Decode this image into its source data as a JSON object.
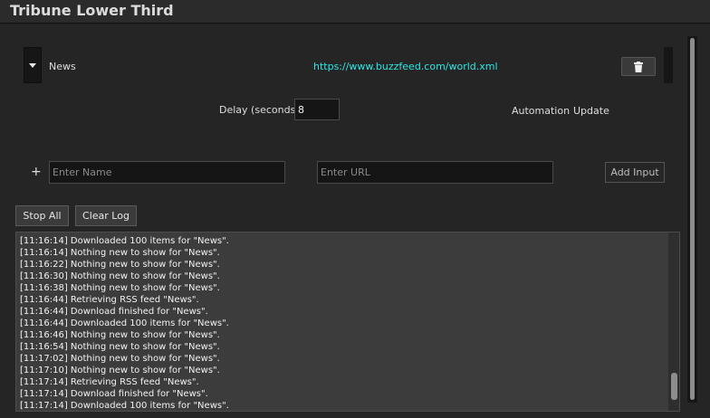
{
  "window": {
    "title": "Tribune Lower Third"
  },
  "feed": {
    "name": "News",
    "url": "https://www.buzzfeed.com/world.xml"
  },
  "settings": {
    "delay_label": "Delay (seconds)",
    "delay_value": "8",
    "automation_label": "Automation",
    "update_label": "Update"
  },
  "add_form": {
    "plus": "+",
    "name_placeholder": "Enter Name",
    "url_placeholder": "Enter URL",
    "add_label": "Add Input"
  },
  "controls": {
    "stop_all_label": "Stop All",
    "clear_log_label": "Clear Log"
  },
  "log": [
    "[11:16:14] Downloaded 100 items for \"News\".",
    "[11:16:14] Nothing new to show for \"News\".",
    "[11:16:22] Nothing new to show for \"News\".",
    "[11:16:30] Nothing new to show for \"News\".",
    "[11:16:38] Nothing new to show for \"News\".",
    "[11:16:44] Retrieving RSS feed \"News\".",
    "[11:16:44] Download finished for \"News\".",
    "[11:16:44] Downloaded 100 items for \"News\".",
    "[11:16:46] Nothing new to show for \"News\".",
    "[11:16:54] Nothing new to show for \"News\".",
    "[11:17:02] Nothing new to show for \"News\".",
    "[11:17:10] Nothing new to show for \"News\".",
    "[11:17:14] Retrieving RSS feed \"News\".",
    "[11:17:14] Download finished for \"News\".",
    "[11:17:14] Downloaded 100 items for \"News\"."
  ],
  "icons": {
    "expand": "caret-down-icon",
    "delete": "trash-icon"
  },
  "colors": {
    "url_text": "#2ee6e6",
    "background": "#1e1e1e",
    "panel": "#252525",
    "log_background": "#3c3c3c"
  }
}
